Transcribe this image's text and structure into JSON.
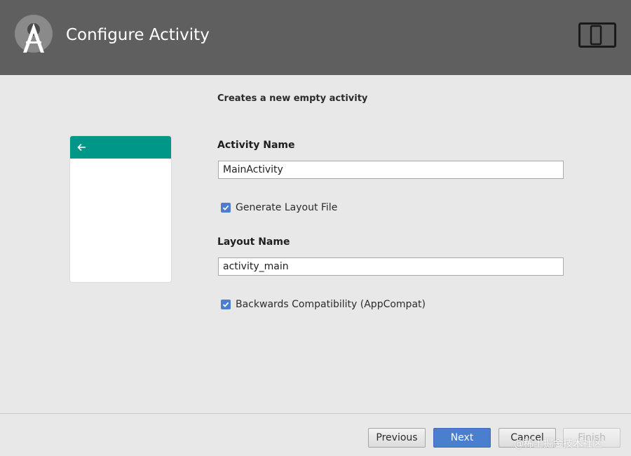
{
  "header": {
    "title": "Configure Activity",
    "background_color": "#5f5f5f",
    "logo_icon": "android-studio-logo-icon",
    "device_icon": "tablet-phone-icon"
  },
  "content": {
    "subtitle": "Creates a new empty activity",
    "preview": {
      "toolbar_color": "#009688",
      "back_icon": "arrow-left-icon"
    },
    "activity_name": {
      "label": "Activity Name",
      "value": "MainActivity"
    },
    "generate_layout": {
      "label": "Generate Layout File",
      "checked": true
    },
    "layout_name": {
      "label": "Layout Name",
      "value": "activity_main"
    },
    "backwards_compat": {
      "label": "Backwards Compatibility (AppCompat)",
      "checked": true
    }
  },
  "footer": {
    "previous_label": "Previous",
    "next_label": "Next",
    "cancel_label": "Cancel",
    "finish_label": "Finish",
    "accent_color": "#4a7fd0"
  },
  "watermark": "@稀土掘金技术社区"
}
